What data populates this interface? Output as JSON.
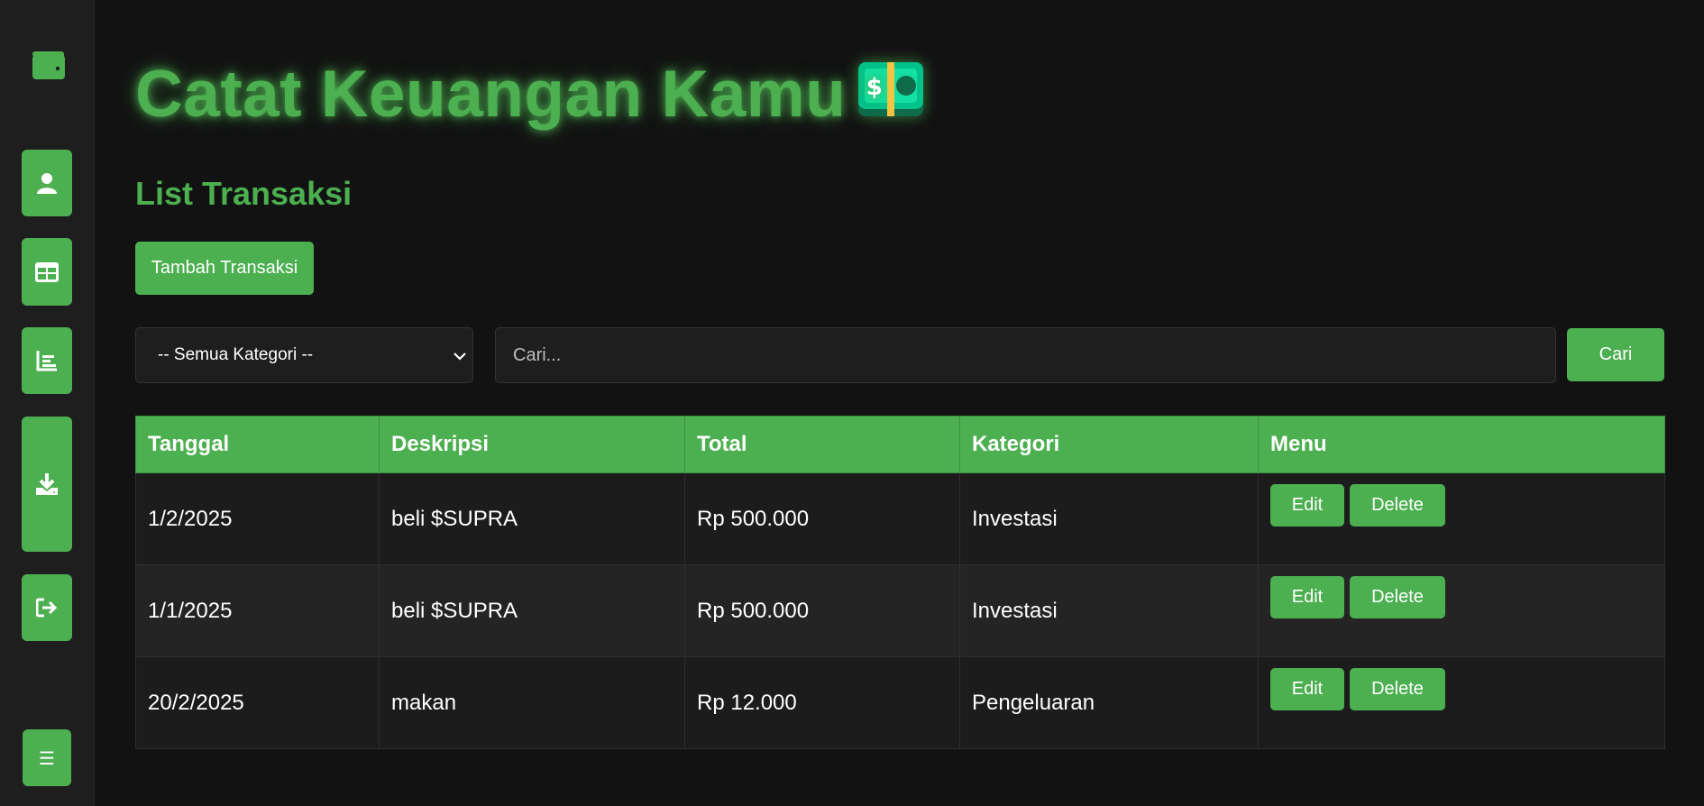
{
  "sidebar": {
    "icons": [
      "wallet-icon",
      "user-icon",
      "table-icon",
      "chart-icon",
      "download-icon",
      "logout-icon",
      "menu-icon"
    ],
    "menu_glyph": "☰"
  },
  "header": {
    "app_title": "Catat Keuangan Kamu",
    "title_emoji": "money-banknote-icon"
  },
  "main": {
    "section_title": "List Transaksi",
    "add_button_label": "Tambah Transaksi",
    "filter": {
      "selected": "-- Semua Kategori --"
    },
    "search": {
      "placeholder": "Cari...",
      "value": "",
      "button_label": "Cari"
    },
    "table": {
      "columns": [
        "Tanggal",
        "Deskripsi",
        "Total",
        "Kategori",
        "Menu"
      ],
      "rows": [
        {
          "tanggal": "1/2/2025",
          "deskripsi": "beli $SUPRA",
          "total": "Rp 500.000",
          "kategori": "Investasi",
          "edit": "Edit",
          "delete": "Delete"
        },
        {
          "tanggal": "1/1/2025",
          "deskripsi": "beli $SUPRA",
          "total": "Rp 500.000",
          "kategori": "Investasi",
          "edit": "Edit",
          "delete": "Delete"
        },
        {
          "tanggal": "20/2/2025",
          "deskripsi": "makan",
          "total": "Rp 12.000",
          "kategori": "Pengeluaran",
          "edit": "Edit",
          "delete": "Delete"
        }
      ]
    }
  },
  "colors": {
    "accent": "#4caf50",
    "background": "#121212",
    "sidebar": "#1e1e1e"
  }
}
